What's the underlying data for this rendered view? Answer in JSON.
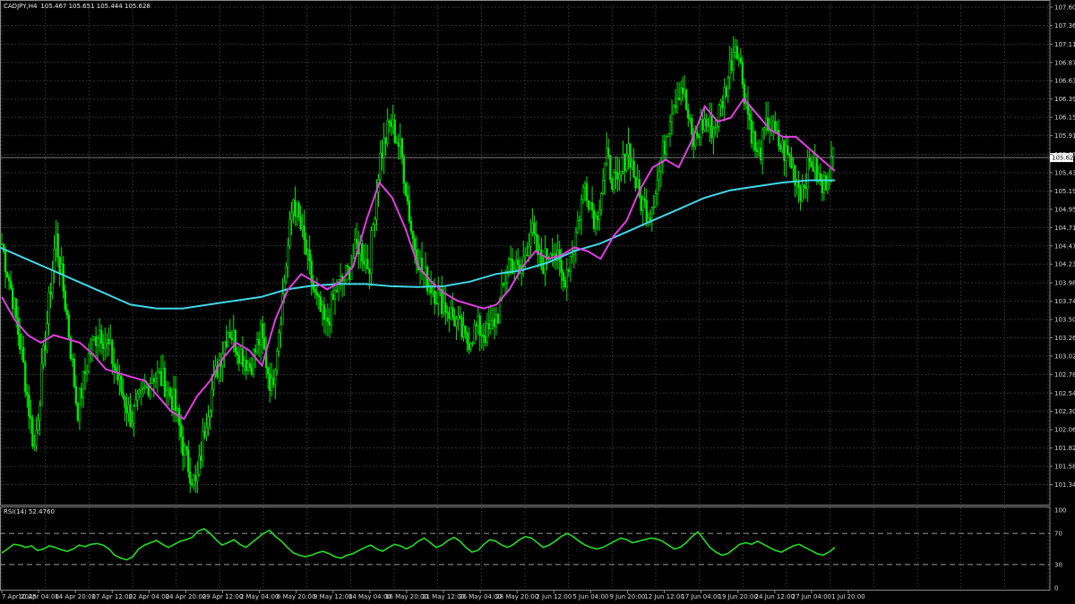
{
  "header": {
    "symbol": "CADJPY,H4",
    "ohlc": "105.467 105.651 105.444 105.628"
  },
  "rsi": {
    "label": "RSI(14) 52.4760"
  },
  "colors": {
    "background": "#000000",
    "grid": "#2f2f2f",
    "candles": "#00e600",
    "ma_fast": "#e63ce6",
    "ma_slow": "#40d8e8",
    "rsi_line": "#22dd22",
    "price_tag_bg": "#ffffff",
    "price_tag_fg": "#000000"
  },
  "chart_data": [
    {
      "type": "line",
      "title": "CADJPY,H4",
      "ylim": [
        101.1,
        107.6
      ],
      "y_ticks": [
        "107.600",
        "107.360",
        "107.115",
        "106.875",
        "106.635",
        "106.395",
        "106.155",
        "105.915",
        "105.670",
        "105.430",
        "105.190",
        "104.950",
        "104.710",
        "104.470",
        "104.230",
        "103.985",
        "103.745",
        "103.505",
        "103.265",
        "103.025",
        "102.785",
        "102.540",
        "102.300",
        "102.060",
        "101.820",
        "101.580",
        "101.340"
      ],
      "current_price": "105.628",
      "x_ticks": [
        "7 Apr 2025",
        "10 Apr 04:00",
        "14 Apr 20:00",
        "17 Apr 12:00",
        "22 Apr 04:00",
        "24 Apr 20:00",
        "29 Apr 12:00",
        "2 May 04:00",
        "6 May 20:00",
        "9 May 12:00",
        "14 May 04:00",
        "16 May 20:00",
        "21 May 12:00",
        "26 May 04:00",
        "28 May 20:00",
        "2 Jun 12:00",
        "5 Jun 04:00",
        "9 Jun 20:00",
        "12 Jun 12:00",
        "17 Jun 04:00",
        "19 Jun 20:00",
        "24 Jun 12:00",
        "27 Jun 04:00",
        "1 Jul 20:00"
      ],
      "price_path": [
        104.5,
        103.8,
        102.9,
        101.8,
        103.2,
        104.6,
        103.6,
        102.3,
        103.0,
        103.4,
        103.1,
        102.6,
        102.2,
        102.5,
        102.8,
        102.7,
        102.4,
        101.7,
        101.3,
        102.3,
        102.9,
        103.4,
        103.1,
        102.9,
        103.3,
        102.6,
        103.8,
        105.1,
        104.5,
        103.8,
        103.4,
        103.9,
        104.1,
        104.5,
        104.2,
        105.6,
        106.1,
        105.7,
        104.6,
        104.1,
        103.9,
        103.7,
        103.5,
        103.2,
        103.4,
        103.3,
        103.6,
        104.3,
        104.1,
        104.7,
        104.2,
        104.5,
        104.0,
        104.5,
        105.3,
        104.8,
        105.6,
        105.2,
        105.8,
        105.1,
        104.9,
        105.5,
        106.3,
        106.6,
        105.8,
        106.1,
        106.0,
        106.5,
        107.2,
        106.3,
        105.6,
        106.1,
        105.8,
        105.6,
        105.2,
        105.6,
        105.2,
        105.628
      ],
      "series": [
        {
          "kind": "moving-average-fast",
          "values": [
            103.8,
            103.5,
            103.3,
            103.2,
            103.3,
            103.25,
            103.2,
            103.05,
            102.85,
            102.8,
            102.75,
            102.7,
            102.5,
            102.3,
            102.2,
            102.5,
            102.7,
            103.0,
            103.2,
            103.1,
            102.9,
            103.5,
            103.9,
            104.1,
            104.0,
            103.9,
            104.0,
            104.2,
            104.8,
            105.3,
            105.1,
            104.7,
            104.2,
            104.0,
            103.85,
            103.75,
            103.7,
            103.65,
            103.7,
            103.9,
            104.2,
            104.4,
            104.3,
            104.35,
            104.45,
            104.4,
            104.3,
            104.6,
            104.8,
            105.2,
            105.5,
            105.6,
            105.5,
            105.85,
            106.3,
            106.1,
            106.15,
            106.4,
            106.2,
            106.0,
            105.9,
            105.9,
            105.75,
            105.6,
            105.45
          ]
        },
        {
          "kind": "moving-average-slow",
          "values": [
            104.45,
            104.3,
            104.15,
            104.0,
            103.85,
            103.7,
            103.65,
            103.65,
            103.7,
            103.75,
            103.8,
            103.9,
            103.95,
            103.97,
            103.97,
            103.94,
            103.93,
            103.94,
            104.0,
            104.1,
            104.15,
            104.25,
            104.4,
            104.5,
            104.65,
            104.8,
            104.95,
            105.1,
            105.2,
            105.25,
            105.3,
            105.33,
            105.33
          ]
        }
      ]
    },
    {
      "type": "line",
      "title": "RSI(14) 52.4760",
      "ylim": [
        0,
        100
      ],
      "y_ticks": [
        "100",
        "70",
        "30",
        "0"
      ],
      "levels": [
        70,
        30
      ],
      "series": [
        {
          "name": "RSI(14)",
          "values": [
            45,
            50,
            56,
            55,
            52,
            54,
            48,
            50,
            54,
            52,
            49,
            47,
            50,
            55,
            53,
            56,
            57,
            55,
            50,
            42,
            38,
            36,
            40,
            50,
            55,
            58,
            61,
            56,
            52,
            56,
            60,
            62,
            65,
            73,
            76,
            70,
            62,
            55,
            58,
            62,
            56,
            52,
            58,
            64,
            70,
            74,
            66,
            60,
            52,
            45,
            42,
            40,
            42,
            45,
            47,
            44,
            40,
            38,
            42,
            44,
            48,
            52,
            55,
            50,
            47,
            52,
            56,
            54,
            50,
            54,
            60,
            64,
            58,
            52,
            55,
            61,
            65,
            60,
            52,
            46,
            48,
            56,
            62,
            60,
            55,
            52,
            56,
            62,
            66,
            64,
            58,
            52,
            55,
            60,
            66,
            70,
            66,
            60,
            55,
            52,
            50,
            52,
            56,
            60,
            64,
            62,
            58,
            60,
            62,
            64,
            63,
            60,
            55,
            50,
            52,
            58,
            66,
            72,
            62,
            52,
            46,
            42,
            44,
            50,
            56,
            58,
            56,
            60,
            56,
            52,
            48,
            46,
            50,
            54,
            56,
            52,
            48,
            44,
            42,
            46,
            52
          ]
        }
      ]
    }
  ]
}
